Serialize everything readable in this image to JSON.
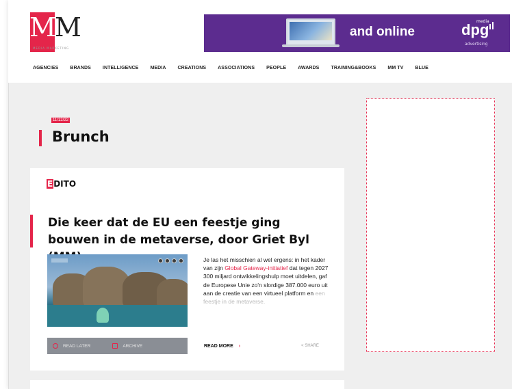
{
  "brand": {
    "logo_letters_1": "M",
    "logo_letters_2": "M",
    "logo_tagline": "MEDIA MARKETING",
    "accent_color": "#e4254a"
  },
  "banner": {
    "text": "and online",
    "brand": "dpg",
    "brand_sup": "media",
    "brand_sub": "advertising",
    "background": "#5c2c8f"
  },
  "nav": {
    "items": [
      "AGENCIES",
      "BRANDS",
      "INTELLIGENCE",
      "MEDIA",
      "CREATIONS",
      "ASSOCIATIONS",
      "PEOPLE",
      "AWARDS",
      "TRAINING&BOOKS",
      "MM TV",
      "BLUE"
    ]
  },
  "page": {
    "date": "11/12/22",
    "title": "Brunch"
  },
  "article": {
    "category_initial": "E",
    "category_rest": "DITO",
    "title": "Die keer dat de EU een feestje ging bouwen in de metaverse, door Griet Byl (MM)",
    "excerpt_before": "Je las het misschien al wel ergens: in het kader van zijn ",
    "excerpt_link": "Global Gateway-initiatief",
    "excerpt_after": " dat tegen 2027 300 miljard ontwikkelingshulp moet uitdelen, gaf de Europese Unie zo'n slordige 387.000 euro uit aan de creatie van een virtueel platform en ",
    "excerpt_fade": "een feestje in de metaverse.",
    "read_later": "READ LATER",
    "archive": "ARCHIVE",
    "read_more": "READ MORE",
    "read_more_chevron": "›",
    "share": "SHARE"
  }
}
